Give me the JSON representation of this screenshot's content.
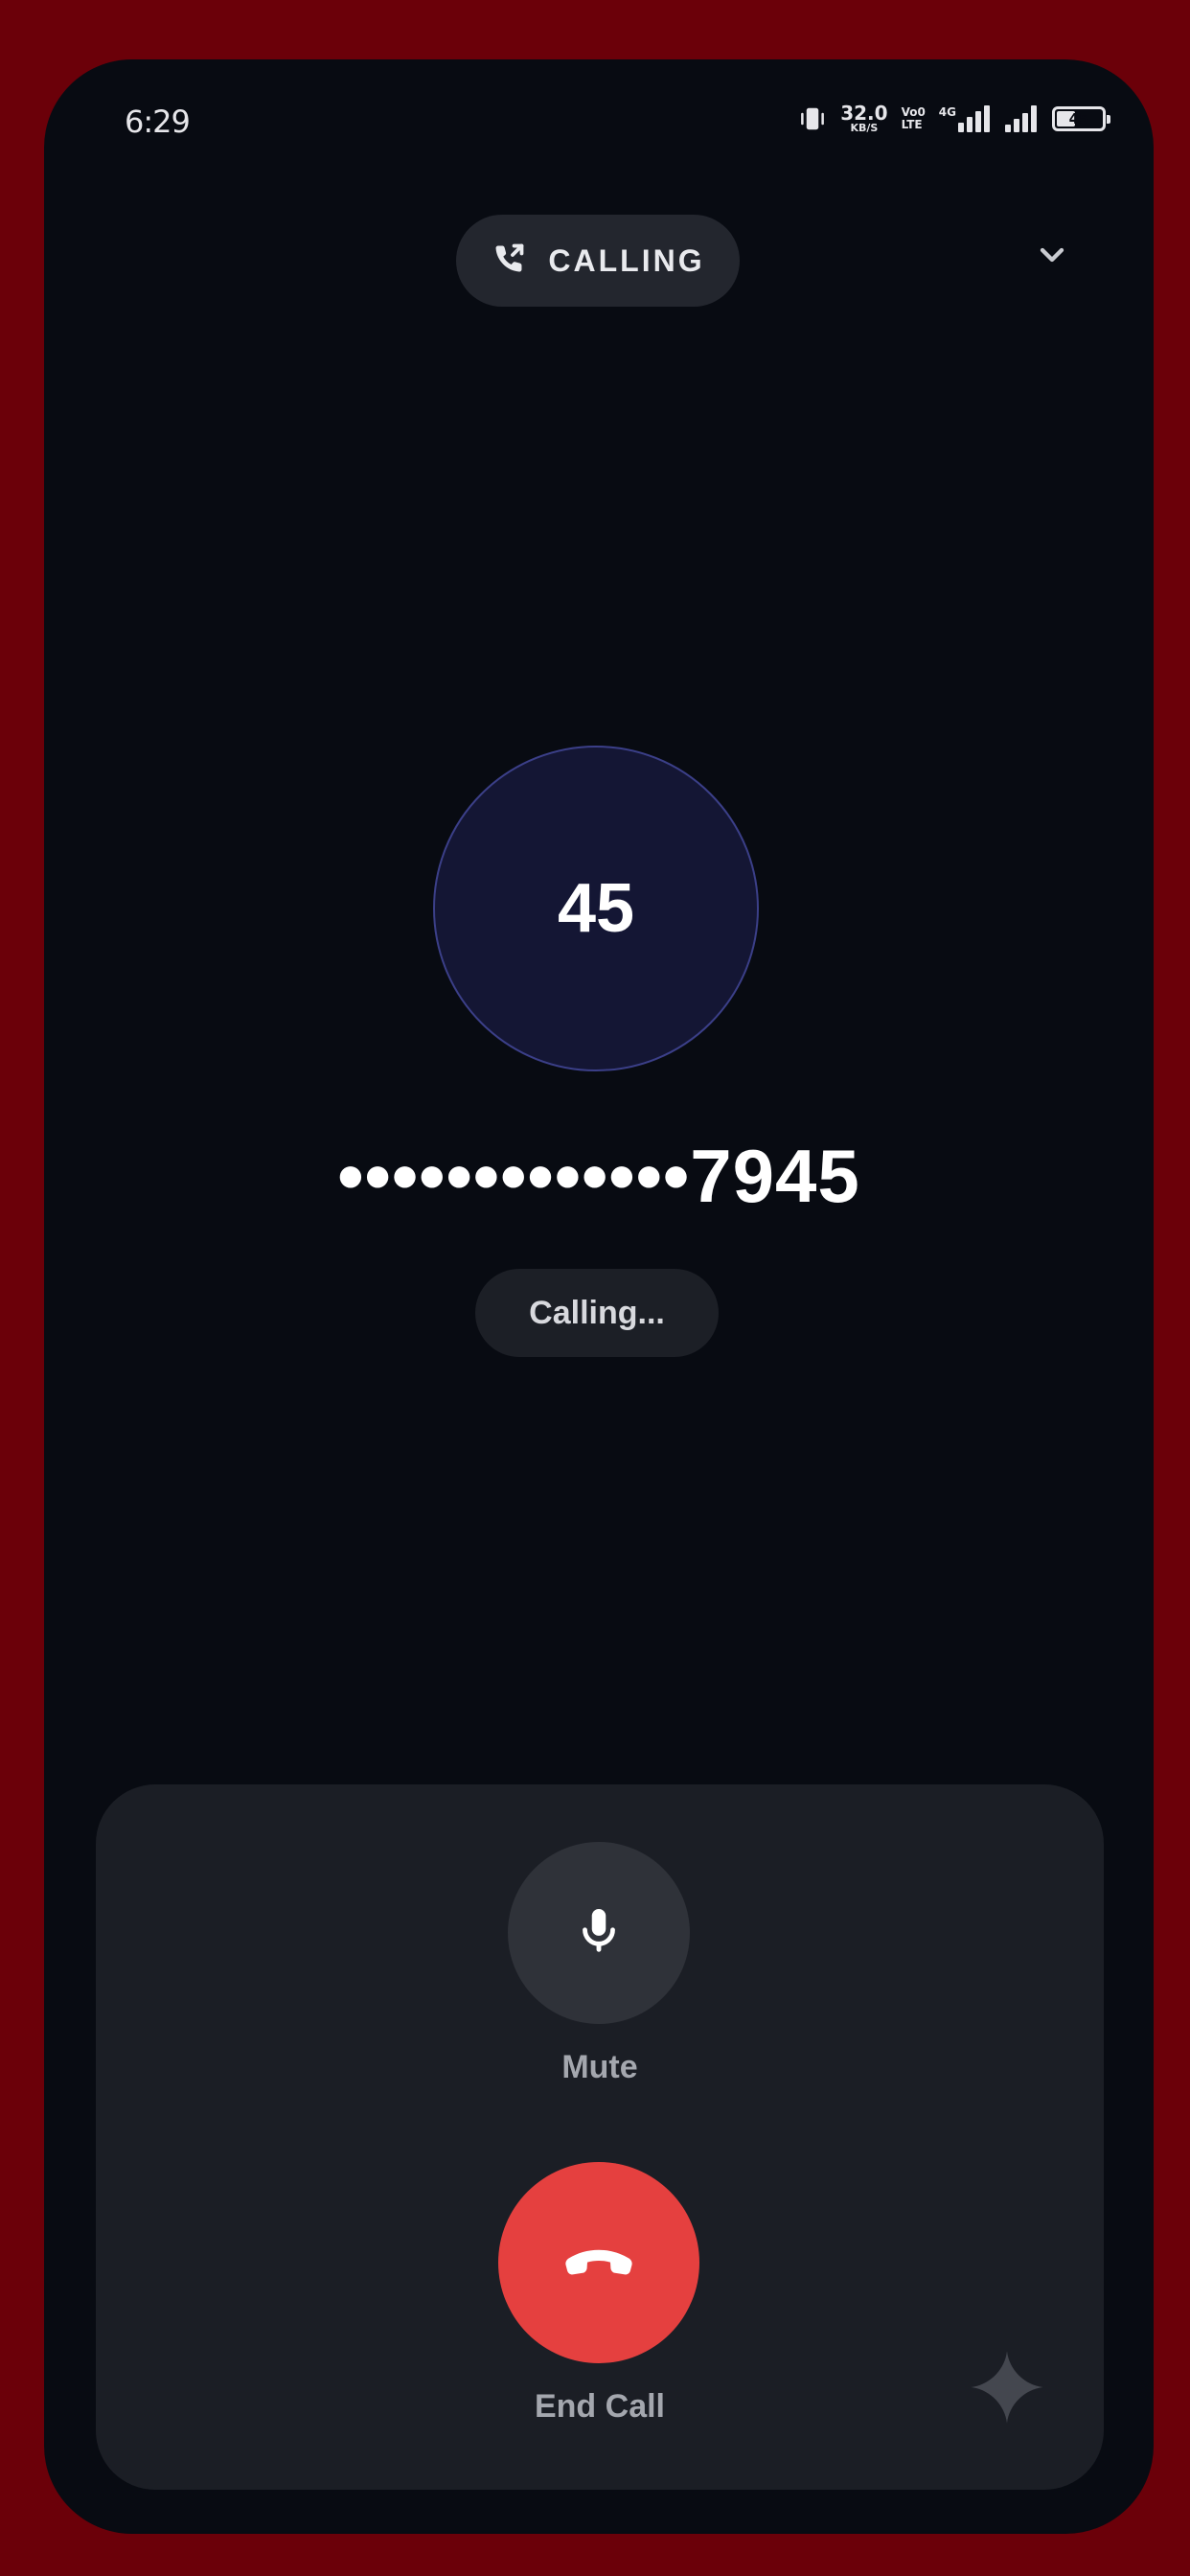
{
  "status_bar": {
    "time": "6:29",
    "net_speed_value": "32.0",
    "net_speed_unit": "KB/S",
    "volte_top": "Vo0",
    "volte_bottom": "LTE",
    "network_type": "4G",
    "battery_level": "45",
    "battery_fraction": 0.45
  },
  "header": {
    "calling_label": "CALLING",
    "phone_icon": "phone-outgoing-icon",
    "collapse_icon": "chevron-down-icon"
  },
  "contact": {
    "avatar_initials": "45",
    "number_masked": "•••••••••••••7945",
    "call_status": "Calling..."
  },
  "controls": {
    "mute_label": "Mute",
    "mute_icon": "microphone-icon",
    "end_call_label": "End Call",
    "end_call_icon": "hang-up-icon",
    "assistant_icon": "sparkle-icon"
  },
  "colors": {
    "background": "#080b12",
    "frame": "#6b0009",
    "end_call": "#e5403f",
    "avatar_fill": "#141634",
    "avatar_ring": "#3b3f88",
    "panel": "#1b1e25"
  }
}
